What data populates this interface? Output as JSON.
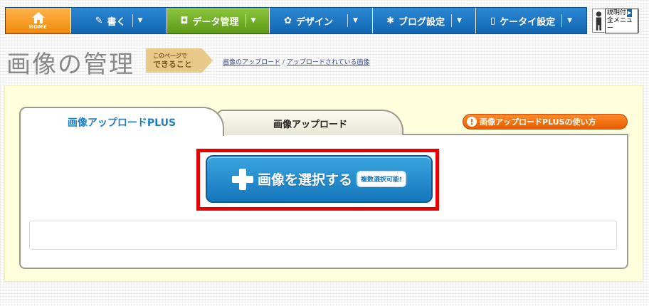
{
  "nav": {
    "home_label": "HOME",
    "items": [
      {
        "label": "書く",
        "icon": "pencil-icon",
        "glyph": "✎"
      },
      {
        "label": "データ管理",
        "icon": "camera-icon",
        "glyph": "◘"
      },
      {
        "label": "デザイン",
        "icon": "design-icon",
        "glyph": "✿"
      },
      {
        "label": "ブログ設定",
        "icon": "gear-icon",
        "glyph": "✱"
      },
      {
        "label": "ケータイ設定",
        "icon": "mobile-icon",
        "glyph": "▯"
      }
    ],
    "caret": "▼",
    "help": {
      "line1": "説明付",
      "line2": "全メニュー",
      "play": "▶"
    }
  },
  "header": {
    "title": "画像の管理",
    "kono_page_line1": "このページで",
    "kono_page_line2": "できること",
    "links": [
      "画像のアップロード",
      "アップロードされている画像"
    ],
    "link_separator": "/"
  },
  "tabs": {
    "active": "画像アップロードPLUS",
    "inactive": "画像アップロード"
  },
  "help_link": {
    "icon_glyph": "!",
    "label": "画像アップロードPLUSの使い方"
  },
  "select_button": {
    "label": "画像を選択する",
    "badge": "複数選択可能!"
  },
  "colors": {
    "nav_blue": "#1469b3",
    "nav_green": "#6aaa1e",
    "home_orange": "#f39a1f",
    "tab_active_text": "#1f7ec2",
    "select_blue": "#1476bb",
    "highlight_red": "#e60000",
    "help_orange": "#f07a1a"
  }
}
